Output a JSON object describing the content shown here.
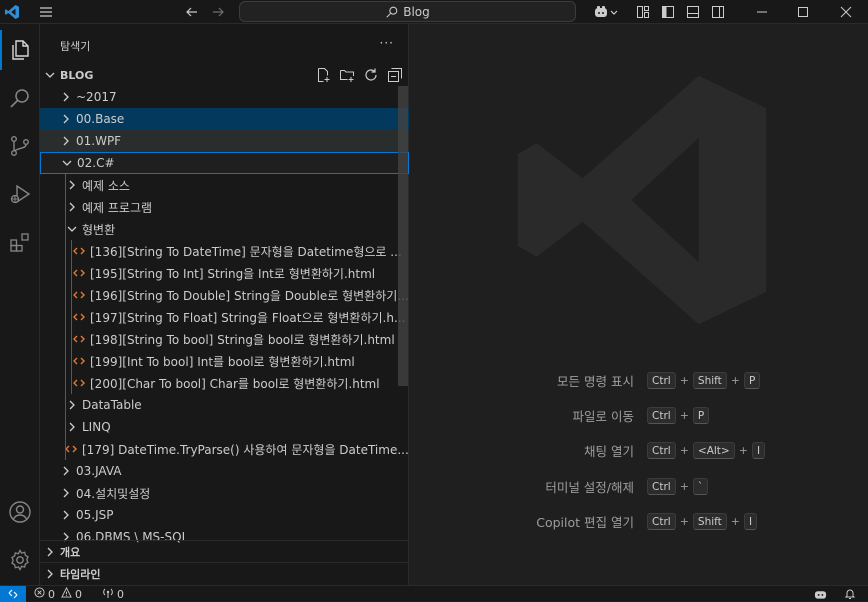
{
  "titlebar": {
    "search_text": "Blog"
  },
  "explorer": {
    "title": "탐색기",
    "more_label": "···",
    "root_label": "BLOG",
    "tree": [
      {
        "label": "~2017",
        "depth": 0,
        "kind": "folder",
        "expanded": false
      },
      {
        "label": "00.Base",
        "depth": 0,
        "kind": "folder",
        "expanded": false,
        "state": "selected"
      },
      {
        "label": "01.WPF",
        "depth": 0,
        "kind": "folder",
        "expanded": false,
        "state": "hover"
      },
      {
        "label": "02.C#",
        "depth": 0,
        "kind": "folder",
        "expanded": true,
        "state": "focus"
      },
      {
        "label": "예제 소스",
        "depth": 1,
        "kind": "folder",
        "expanded": false
      },
      {
        "label": "예제 프로그램",
        "depth": 1,
        "kind": "folder",
        "expanded": false
      },
      {
        "label": "형변환",
        "depth": 1,
        "kind": "folder",
        "expanded": true
      },
      {
        "label": "[136][String To DateTime] 문자형을 Datetime형으로 ...",
        "depth": 2,
        "kind": "html"
      },
      {
        "label": "[195][String To Int] String을 Int로 형변환하기.html",
        "depth": 2,
        "kind": "html"
      },
      {
        "label": "[196][String To Double] String을 Double로 형변환하기...",
        "depth": 2,
        "kind": "html"
      },
      {
        "label": "[197][String To Float] String을 Float으로 형변환하기.h...",
        "depth": 2,
        "kind": "html"
      },
      {
        "label": "[198][String To bool] String을 bool로 형변환하기.html",
        "depth": 2,
        "kind": "html"
      },
      {
        "label": "[199][Int To bool] Int를 bool로 형변환하기.html",
        "depth": 2,
        "kind": "html"
      },
      {
        "label": "[200][Char To bool] Char를 bool로 형변환하기.html",
        "depth": 2,
        "kind": "html"
      },
      {
        "label": "DataTable",
        "depth": 1,
        "kind": "folder",
        "expanded": false
      },
      {
        "label": "LINQ",
        "depth": 1,
        "kind": "folder",
        "expanded": false
      },
      {
        "label": "[179] DateTime.TryParse() 사용하여 문자형을 DateTime...",
        "depth": 1,
        "kind": "html"
      },
      {
        "label": "03.JAVA",
        "depth": 0,
        "kind": "folder",
        "expanded": false
      },
      {
        "label": "04.설치및설정",
        "depth": 0,
        "kind": "folder",
        "expanded": false
      },
      {
        "label": "05.JSP",
        "depth": 0,
        "kind": "folder",
        "expanded": false
      },
      {
        "label": "06.DBMS \\ MS-SQL",
        "depth": 0,
        "kind": "folder",
        "expanded": false
      }
    ],
    "outline_label": "개요",
    "timeline_label": "타임라인"
  },
  "welcome_hints": [
    {
      "label": "모든 명령 표시",
      "keys": [
        "Ctrl",
        "Shift",
        "P"
      ]
    },
    {
      "label": "파일로 이동",
      "keys": [
        "Ctrl",
        "P"
      ]
    },
    {
      "label": "채팅 열기",
      "keys": [
        "Ctrl",
        "<Alt>",
        "I"
      ]
    },
    {
      "label": "터미널 설정/해제",
      "keys": [
        "Ctrl",
        "`"
      ]
    },
    {
      "label": "Copilot 편집 열기",
      "keys": [
        "Ctrl",
        "Shift",
        "I"
      ]
    }
  ],
  "statusbar": {
    "errors": "0",
    "warnings": "0",
    "ports": "0"
  },
  "colors": {
    "accent": "#0078d4",
    "selection": "#04395e",
    "html_icon": "#e37933",
    "background": "#1f1f1f",
    "sidebar": "#181818"
  }
}
